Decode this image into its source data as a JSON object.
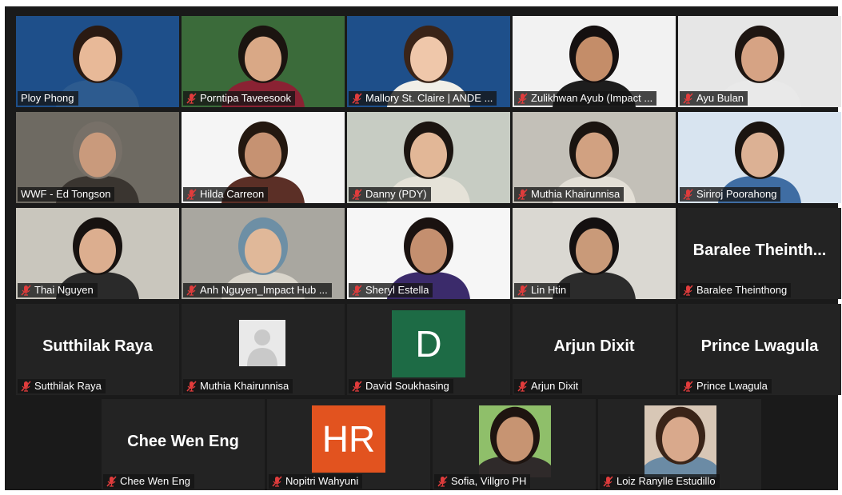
{
  "participants": [
    {
      "name": "Ploy Phong",
      "display": "",
      "active": true,
      "muted": false,
      "bg": "#1e4f8a",
      "skin": "#e8b998",
      "hair": "#2a1a12",
      "shirt": "#2d5b8f"
    },
    {
      "name": "Porntipa Taveesook",
      "display": "",
      "muted": true,
      "bg": "#3b6b3a",
      "skin": "#d9a886",
      "hair": "#1b1410",
      "shirt": "#8a2233"
    },
    {
      "name": "Mallory St. Claire | ANDE ...",
      "display": "",
      "muted": true,
      "bg": "#1e4f8a",
      "skin": "#efc7aa",
      "hair": "#3a2418",
      "shirt": "#f1efe8"
    },
    {
      "name": "Zulikhwan Ayub (Impact ...",
      "display": "",
      "muted": true,
      "bg": "#f2f2f2",
      "skin": "#c48d69",
      "hair": "#151010",
      "shirt": "#1d1d1d"
    },
    {
      "name": "Ayu Bulan",
      "display": "",
      "muted": true,
      "bg": "#e6e6e6",
      "skin": "#d6a384",
      "hair": "#1e1612",
      "shirt": "#e9e9e9"
    },
    {
      "name": "WWF - Ed Tongson",
      "display": "",
      "muted": false,
      "bg": "#6e6a62",
      "skin": "#c99a7c",
      "hair": "#777068",
      "shirt": "#3a3530"
    },
    {
      "name": "Hilda Carreon",
      "display": "",
      "muted": true,
      "bg": "#f5f5f5",
      "skin": "#c69272",
      "hair": "#241810",
      "shirt": "#5b2f26"
    },
    {
      "name": "Danny (PDY)",
      "display": "",
      "muted": true,
      "bg": "#c7ccc3",
      "skin": "#e2b797",
      "hair": "#1b1410",
      "shirt": "#e5e2d8"
    },
    {
      "name": "Muthia Khairunnisa",
      "display": "",
      "muted": true,
      "bg": "#c3c0b8",
      "skin": "#d1a181",
      "hair": "#1a1410",
      "shirt": "#e3dfd6"
    },
    {
      "name": "Siriroj Poorahong",
      "display": "",
      "muted": true,
      "bg": "#d8e4f0",
      "skin": "#dcb194",
      "hair": "#1a1410",
      "shirt": "#3f6da3"
    },
    {
      "name": "Thai Nguyen",
      "display": "",
      "muted": true,
      "bg": "#c9c6bd",
      "skin": "#dcae8f",
      "hair": "#171210",
      "shirt": "#2a2a2a"
    },
    {
      "name": "Anh Nguyen_Impact Hub ...",
      "display": "",
      "muted": true,
      "bg": "#a9a7a0",
      "skin": "#e0b899",
      "hair": "#6d8fa5",
      "shirt": "#d9d5cb"
    },
    {
      "name": "Sheryl Estella",
      "display": "",
      "muted": true,
      "bg": "#f6f6f6",
      "skin": "#c48f6f",
      "hair": "#1a1210",
      "shirt": "#3b2b6b"
    },
    {
      "name": "Lin Htin",
      "display": "",
      "muted": true,
      "bg": "#dad8d2",
      "skin": "#c99a79",
      "hair": "#141010",
      "shirt": "#2b2b2b"
    },
    {
      "name": "Baralee Theinthong",
      "display": "Baralee Theinth...",
      "muted": true
    },
    {
      "name": "Sutthilak Raya",
      "display": "Sutthilak Raya",
      "muted": true
    },
    {
      "name": "Muthia Khairunnisa",
      "display": "",
      "muted": true,
      "avatar": "blank"
    },
    {
      "name": "David Soukhasing",
      "display": "D",
      "muted": true,
      "avatar": "letter",
      "avatar_color": "#1d6b45"
    },
    {
      "name": "Arjun Dixit",
      "display": "Arjun Dixit",
      "muted": true
    },
    {
      "name": "Prince Lwagula",
      "display": "Prince Lwagula",
      "muted": true
    },
    {
      "name": "Chee Wen Eng",
      "display": "Chee Wen Eng",
      "muted": true
    },
    {
      "name": "Nopitri Wahyuni",
      "display": "HR",
      "muted": true,
      "avatar": "letter",
      "avatar_color": "#e2531f"
    },
    {
      "name": "Sofia, Villgro PH",
      "display": "",
      "muted": true,
      "avatar": "photo",
      "bg": "#8fbf6a",
      "skin": "#c79472",
      "hair": "#1e1410",
      "shirt": "#2f2a2a"
    },
    {
      "name": "Loiz Ranylle Estudillo",
      "display": "",
      "muted": true,
      "avatar": "photo",
      "bg": "#d8c7b6",
      "skin": "#d9a98c",
      "hair": "#3a2418",
      "shirt": "#6b8ba5"
    }
  ],
  "colors": {
    "meeting_bg": "#1a1a1a",
    "tile_bg": "#232323",
    "active_border": "#e5e86a",
    "mute_red": "#e03c3c"
  }
}
